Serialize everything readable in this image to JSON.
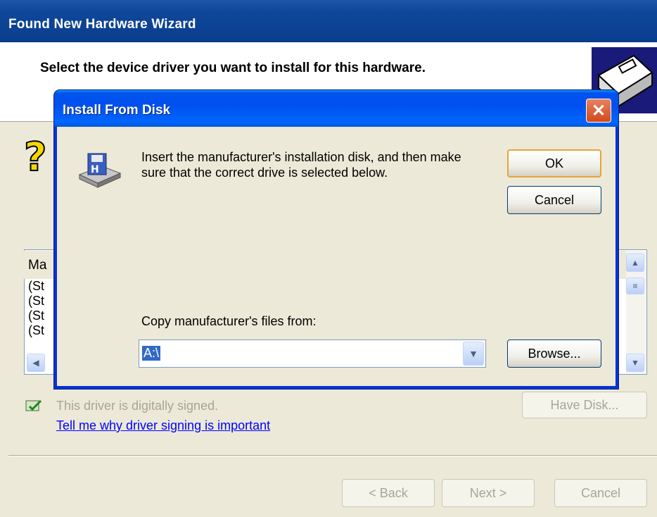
{
  "wizard": {
    "title": "Found New Hardware Wizard",
    "header_title": "Select the device driver you want to install for this hardware.",
    "list_header": "Ma",
    "list_rows": [
      "(St",
      "(St",
      "(St",
      "(St"
    ],
    "signed_text": "This driver is digitally signed.",
    "signing_link": "Tell me why driver signing is important",
    "have_disk_label": "Have Disk...",
    "back_label": "< Back",
    "next_label": "Next >",
    "cancel_label": "Cancel"
  },
  "dialog": {
    "title": "Install From Disk",
    "message": "Insert the manufacturer's installation disk, and then make sure that the correct drive is selected below.",
    "ok_label": "OK",
    "cancel_label": "Cancel",
    "copy_label": "Copy manufacturer's files from:",
    "path_value": "A:\\",
    "browse_label": "Browse..."
  },
  "icons": {
    "close": "close-icon",
    "hardware": "hardware-icon",
    "question": "question-icon",
    "disk": "floppy-disk-icon",
    "signed": "signed-driver-icon"
  }
}
